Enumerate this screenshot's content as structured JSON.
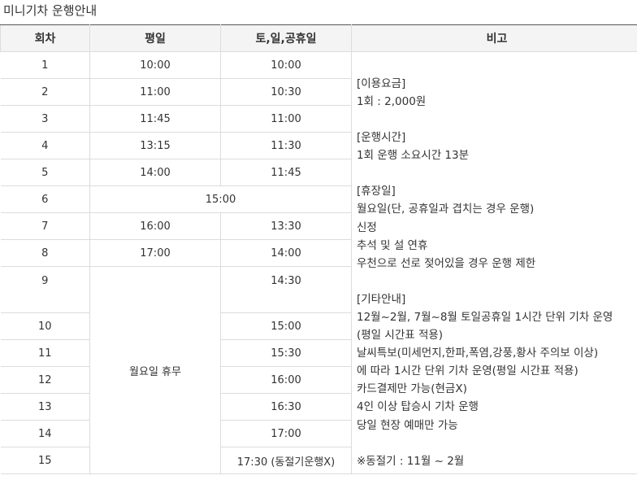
{
  "page": {
    "title": "미니기차 운행안내"
  },
  "table": {
    "headers": {
      "round": "회차",
      "weekday": "평일",
      "weekend": "토,일,공휴일",
      "notes": "비고"
    },
    "rows": [
      {
        "round": "1",
        "weekday": "10:00",
        "weekend": "10:00"
      },
      {
        "round": "2",
        "weekday": "11:00",
        "weekend": "10:30"
      },
      {
        "round": "3",
        "weekday": "11:45",
        "weekend": "11:00"
      },
      {
        "round": "4",
        "weekday": "13:15",
        "weekend": "11:30"
      },
      {
        "round": "5",
        "weekday": "14:00",
        "weekend": "11:45"
      },
      {
        "round": "6",
        "weekday": "15:00",
        "weekend": ""
      },
      {
        "round": "7",
        "weekday": "16:00",
        "weekend": "13:30"
      },
      {
        "round": "8",
        "weekday": "17:00",
        "weekend": "14:00"
      },
      {
        "round": "9",
        "weekday": "",
        "weekend": "14:30"
      },
      {
        "round": "10",
        "weekday": "",
        "weekend": "15:00"
      },
      {
        "round": "11",
        "weekday": "",
        "weekend": "15:30"
      },
      {
        "round": "12",
        "weekday": "",
        "weekend": "16:00"
      },
      {
        "round": "13",
        "weekday": "",
        "weekend": "16:30"
      },
      {
        "round": "14",
        "weekday": "",
        "weekend": "17:00"
      },
      {
        "round": "15",
        "weekday": "",
        "weekend": "17:30 (동절기운행X)"
      }
    ],
    "weekday_closed_label": "월요일 휴무",
    "notes": {
      "fee_title": "[이용요금]",
      "fee_1": " 1회 : 2,000원",
      "hours_title": "[운행시간]",
      "hours_1": " 1회 운행 소요시간 13분",
      "closed_title": "[휴장일]",
      "closed_1": " 월요일(단, 공휴일과 겹치는 경우 운행)",
      "closed_2": " 신정",
      "closed_3": " 추석 및 설 연휴",
      "closed_4": " 우천으로 선로 젖어있을 경우 운행 제한",
      "etc_title": "[기타안내]",
      "etc_1": " 12월~2월, 7월~8월 토일공휴일 1시간 단위 기차 운영",
      "etc_2": "(평일 시간표 적용)",
      "etc_3": " 날씨특보(미세먼지,한파,폭염,강풍,황사 주의보 이상)",
      "etc_4": "에 따라 1시간 단위 기차 운영(평일 시간표 적용)",
      "etc_5": " 카드결제만 가능(현금X)",
      "etc_6": " 4인 이상 탑승시 기차 운행",
      "etc_7": " 당일 현장 예매만 가능",
      "winter": "※동절기 : 11월 ~ 2월"
    }
  }
}
